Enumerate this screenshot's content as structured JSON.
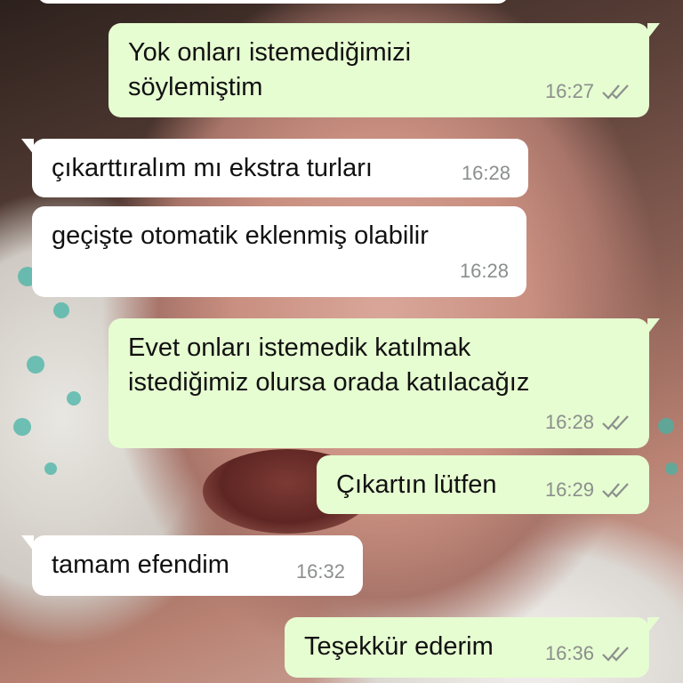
{
  "colors": {
    "outgoing_bubble": "#e6fcd1",
    "incoming_bubble": "#ffffff",
    "timestamp": "#8b8f8c",
    "read_ticks": "#8b8f8c"
  },
  "messages": [
    {
      "direction": "outgoing",
      "text": "Yok onları istemediğimizi\nsöylemiştim",
      "time": "16:27",
      "status": "read-ticks-icon"
    },
    {
      "direction": "incoming",
      "text": "çıkarttıralım mı ekstra turları",
      "time": "16:28"
    },
    {
      "direction": "incoming",
      "text": "geçişte otomatik eklenmiş olabilir",
      "time": "16:28"
    },
    {
      "direction": "outgoing",
      "text": "Evet onları istemedik katılmak\nistediğimiz olursa orada katılacağız",
      "time": "16:28",
      "status": "read-ticks-icon"
    },
    {
      "direction": "outgoing",
      "text": "Çıkartın lütfen",
      "time": "16:29",
      "status": "read-ticks-icon"
    },
    {
      "direction": "incoming",
      "text": "tamam efendim",
      "time": "16:32"
    },
    {
      "direction": "outgoing",
      "text": "Teşekkür ederim",
      "time": "16:36",
      "status": "read-ticks-icon"
    }
  ]
}
